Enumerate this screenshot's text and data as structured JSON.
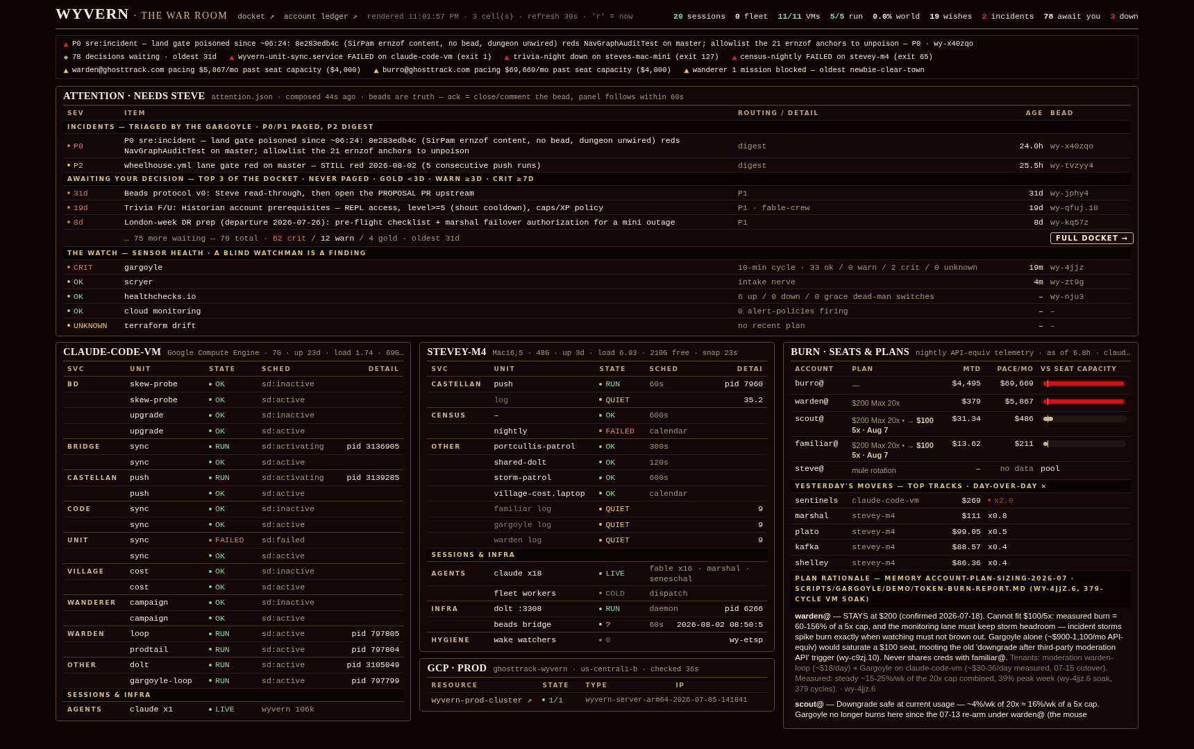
{
  "header": {
    "logo": "WYVERN",
    "subtitle": "· THE WAR ROOM",
    "links": [
      {
        "label": "docket ↗"
      },
      {
        "label": "account ledger ↗"
      }
    ],
    "meta": "rendered 11:01:57 PM · 3 cell(s) · refresh 30s · 'r' = now",
    "stats": [
      {
        "count": "20",
        "text": "sessions",
        "color": "#8fd49a"
      },
      {
        "count": "0",
        "text": "fleet",
        "color": "#f2e8d4"
      },
      {
        "count": "11/11",
        "text": "VMs",
        "color": "#8fd49a"
      },
      {
        "count": "5/5",
        "text": "run",
        "color": "#8fd49a"
      },
      {
        "count": "0.0%",
        "text": "world",
        "color": "#f2e8d4"
      },
      {
        "count": "19",
        "text": "wishes",
        "color": "#f2e8d4"
      },
      {
        "count": "2",
        "text": "incidents",
        "color": "#e03030"
      },
      {
        "count": "78",
        "text": "await you",
        "color": "#f2e8d4"
      },
      {
        "count": "3",
        "text": "down",
        "color": "#e03030"
      }
    ]
  },
  "alerts": [
    {
      "items": [
        {
          "kind": "crit",
          "text": "P0 sre:incident — land gate poisoned since ~06:24: 8e283edb4c (SirPam ernzof content, no bead, dungeon unwired) reds NavGraphAuditTest on master; allowlist the 21 ernzof anchors to unpoison — P0 · wy-x40zqo"
        }
      ]
    },
    {
      "items": [
        {
          "kind": "decision",
          "text": "78 decisions waiting · oldest 31d"
        },
        {
          "kind": "crit",
          "text": "wyvern-unit-sync.service FAILED on claude-code-vm (exit 1)"
        },
        {
          "kind": "crit",
          "text": "trivia-night down on steves-mac-mini (exit 127)"
        },
        {
          "kind": "crit",
          "text": "census-nightly FAILED on stevey-m4 (exit 65)"
        }
      ]
    },
    {
      "items": [
        {
          "kind": "warn",
          "text": "warden@ghosttrack.com pacing $5,867/mo past seat capacity ($4,000)"
        },
        {
          "kind": "warn",
          "text": "burro@ghosttrack.com pacing $69,669/mo past seat capacity ($4,000)"
        },
        {
          "kind": "warn",
          "text": "wanderer 1 mission blocked — oldest newbie-clear-town"
        }
      ]
    }
  ],
  "attention": {
    "title": "ATTENTION · NEEDS STEVE",
    "meta": "attention.json · composed 44s ago · beads are truth — ack = close/comment the bead, panel follows within 60s",
    "columns": [
      "SEV",
      "ITEM",
      "ROUTING / DETAIL",
      "AGE",
      "BEAD"
    ],
    "rows": [
      {
        "kind": "section",
        "text": "INCIDENTS — TRIAGED BY THE GARGOYLE · P0/P1 PAGED, P2 DIGEST"
      },
      {
        "kind": "item",
        "sev": "P0",
        "color": "#d0805e",
        "item": "P0 sre:incident — land gate poisoned since ~06:24: 8e283edb4c (SirPam ernzof content, no bead, dungeon unwired) reds NavGraphAuditTest on master; allowlist the 21 ernzof anchors to unpoison",
        "detail": "digest",
        "age": "24.0h",
        "bead": "wy-x40zqo"
      },
      {
        "kind": "item",
        "sev": "P2",
        "color": "#e2c46e",
        "item": "wheelhouse.yml lane gate red on master — STILL red 2026-08-02 (5 consecutive push runs)",
        "detail": "digest",
        "age": "25.5h",
        "bead": "wy-tvzyy4"
      },
      {
        "kind": "section",
        "text": "AWAITING YOUR DECISION — TOP 3 OF THE DOCKET · NEVER PAGED · GOLD <3D · WARN ≥3D · CRIT ≥7D"
      },
      {
        "kind": "item",
        "sev": "31d",
        "color": "#d0805e",
        "item": "Beads protocol v0: Steve read-through, then open the PROPOSAL PR upstream",
        "detail": "P1",
        "age": "31d",
        "bead": "wy-jphy4"
      },
      {
        "kind": "item",
        "sev": "19d",
        "color": "#d0805e",
        "item": "Trivia F/U: Historian account prerequisites — REPL access, level>=5 (shout cooldown), caps/XP policy",
        "detail": "P1 · fable-crew",
        "age": "19d",
        "bead": "wy-qfuj.10"
      },
      {
        "kind": "item",
        "sev": "8d",
        "color": "#d0805e",
        "item": "London-week DR prep (departure 2026-07-26): pre-flight checklist + marshal failover authorization for a mini outage",
        "detail": "P1",
        "age": "8d",
        "bead": "wy-kq57z"
      },
      {
        "kind": "more",
        "parts": [
          {
            "text": "… 75 more waiting — 78 total · "
          },
          {
            "text": "62 crit",
            "color": "#d0805e"
          },
          {
            "text": " / "
          },
          {
            "text": "12 warn",
            "color": "#f2e8d4"
          },
          {
            "text": " / 4 gold · oldest 31d"
          }
        ],
        "button": "FULL DOCKET →"
      },
      {
        "kind": "section",
        "text": "THE WATCH — SENSOR HEALTH · A BLIND WATCHMAN IS A FINDING"
      },
      {
        "kind": "item",
        "sev": "CRIT",
        "color": "#d0805e",
        "item": "gargoyle",
        "detail": "10-min cycle · 33 ok / 0 warn / 2 crit / 0 unknown",
        "age": "19m",
        "bead": "wy-4jjz"
      },
      {
        "kind": "item",
        "sev": "OK",
        "color": "#8fd49a",
        "item": "scryer",
        "detail": "intake nerve",
        "age": "4m",
        "bead": "wy-zt9g"
      },
      {
        "kind": "item",
        "sev": "OK",
        "color": "#8fd49a",
        "item": "healthchecks.io",
        "detail": "6 up / 0 down / 0 grace dead-man switches",
        "age": "–",
        "bead": "wy-nju3"
      },
      {
        "kind": "item",
        "sev": "OK",
        "color": "#8fd49a",
        "item": "cloud monitoring",
        "detail": "0 alert-policies firing",
        "age": "–",
        "bead": "–"
      },
      {
        "kind": "item",
        "sev": "UNKNOWN",
        "color": "#e2c46e",
        "item": "terraform drift",
        "detail": "no recent plan",
        "age": "–",
        "bead": "–"
      }
    ]
  },
  "claude_vm": {
    "title": "CLAUDE-CODE-VM",
    "meta": "Google Compute Engine · 7G · up 23d · load 1.74 · 69G…",
    "columns": [
      "SVC",
      "UNIT",
      "STATE",
      "SCHED",
      "DETAIL"
    ],
    "groups": [
      {
        "svc": "BD",
        "rows": [
          {
            "unit": "skew-probe",
            "state": "OK",
            "color": "#8fd49a",
            "sched": "sd:inactive"
          },
          {
            "unit": "skew-probe",
            "state": "OK",
            "color": "#8fd49a",
            "sched": "sd:active"
          },
          {
            "unit": "upgrade",
            "state": "OK",
            "color": "#8fd49a",
            "sched": "sd:inactive"
          },
          {
            "unit": "upgrade",
            "state": "OK",
            "color": "#8fd49a",
            "sched": "sd:active"
          }
        ]
      },
      {
        "svc": "BRIDGE",
        "rows": [
          {
            "unit": "sync",
            "state": "RUN",
            "color": "#8fd49a",
            "sched": "sd:activating",
            "detail": "pid 3136905"
          },
          {
            "unit": "sync",
            "state": "OK",
            "color": "#8fd49a",
            "sched": "sd:active"
          }
        ]
      },
      {
        "svc": "CASTELLAN",
        "rows": [
          {
            "unit": "push",
            "state": "RUN",
            "color": "#8fd49a",
            "sched": "sd:activating",
            "detail": "pid 3139285"
          },
          {
            "unit": "push",
            "state": "OK",
            "color": "#8fd49a",
            "sched": "sd:active"
          }
        ]
      },
      {
        "svc": "CODE",
        "rows": [
          {
            "unit": "sync",
            "state": "OK",
            "color": "#8fd49a",
            "sched": "sd:inactive"
          },
          {
            "unit": "sync",
            "state": "OK",
            "color": "#8fd49a",
            "sched": "sd:active"
          }
        ]
      },
      {
        "svc": "UNIT",
        "rows": [
          {
            "unit": "sync",
            "state": "FAILED",
            "color": "#c98a6e",
            "sched": "sd:failed"
          },
          {
            "unit": "sync",
            "state": "OK",
            "color": "#8fd49a",
            "sched": "sd:active"
          }
        ]
      },
      {
        "svc": "VILLAGE",
        "rows": [
          {
            "unit": "cost",
            "state": "OK",
            "color": "#8fd49a",
            "sched": "sd:inactive"
          },
          {
            "unit": "cost",
            "state": "OK",
            "color": "#8fd49a",
            "sched": "sd:active"
          }
        ]
      },
      {
        "svc": "WANDERER",
        "rows": [
          {
            "unit": "campaign",
            "state": "OK",
            "color": "#8fd49a",
            "sched": "sd:inactive"
          },
          {
            "unit": "campaign",
            "state": "OK",
            "color": "#8fd49a",
            "sched": "sd:active"
          }
        ]
      },
      {
        "svc": "WARDEN",
        "rows": [
          {
            "unit": "loop",
            "state": "RUN",
            "color": "#8fd49a",
            "sched": "sd:active",
            "detail": "pid 797805"
          },
          {
            "unit": "prodtail",
            "state": "RUN",
            "color": "#8fd49a",
            "sched": "sd:active",
            "detail": "pid 797804"
          }
        ]
      },
      {
        "svc": "OTHER",
        "rows": [
          {
            "unit": "dolt",
            "state": "RUN",
            "color": "#8fd49a",
            "sched": "sd:active",
            "detail": "pid 3105049"
          },
          {
            "unit": "gargoyle-loop",
            "state": "RUN",
            "color": "#8fd49a",
            "sched": "sd:active",
            "detail": "pid 797799"
          }
        ]
      }
    ],
    "infra": {
      "title": "SESSIONS & INFRA",
      "groups": [
        {
          "svc": "AGENTS",
          "rows": [
            {
              "unit": "claude x1",
              "state": "LIVE",
              "color": "#8fd49a",
              "sched": "wyvern 106k"
            }
          ]
        }
      ]
    }
  },
  "stevey_m4": {
    "title": "STEVEY-M4",
    "meta": "Mac16,5 · 48G · up 3d · load 6.93 · 210G free · snap 23s",
    "columns": [
      "SVC",
      "UNIT",
      "STATE",
      "SCHED",
      "DETAI"
    ],
    "groups": [
      {
        "svc": "CASTELLAN",
        "rows": [
          {
            "unit": "push",
            "dim": false,
            "state": "RUN",
            "color": "#8fd49a",
            "sched": "60s",
            "detail": "pid 7960"
          },
          {
            "unit": "log",
            "dim": true,
            "state": "QUIET",
            "color": "#e2c46e",
            "detail": "35.2"
          }
        ]
      },
      {
        "svc": "CENSUS",
        "rows": [
          {
            "unit": "–",
            "dim": false,
            "state": "OK",
            "color": "#8fd49a",
            "sched": "600s"
          },
          {
            "unit": "nightly",
            "dim": false,
            "state": "FAILED",
            "color": "#d39070",
            "sched": "calendar"
          }
        ]
      },
      {
        "svc": "OTHER",
        "rows": [
          {
            "unit": "portcullis-patrol",
            "dim": false,
            "state": "OK",
            "color": "#8fd49a",
            "sched": "300s"
          },
          {
            "unit": "shared-dolt",
            "dim": false,
            "state": "OK",
            "color": "#8fd49a",
            "sched": "120s"
          },
          {
            "unit": "storm-patrol",
            "dim": false,
            "state": "OK",
            "color": "#8fd49a",
            "sched": "600s"
          },
          {
            "unit": "village-cost.laptop",
            "dim": false,
            "state": "OK",
            "color": "#8fd49a",
            "sched": "calendar"
          },
          {
            "unit": "familiar log",
            "dim": true,
            "state": "QUIET",
            "color": "#e2c46e",
            "detail": "9"
          },
          {
            "unit": "gargoyle log",
            "dim": true,
            "state": "QUIET",
            "color": "#e2c46e",
            "detail": "9"
          },
          {
            "unit": "warden log",
            "dim": true,
            "state": "QUIET",
            "color": "#e2c46e",
            "detail": "9"
          }
        ]
      }
    ],
    "infra": {
      "title": "SESSIONS & INFRA",
      "groups": [
        {
          "svc": "AGENTS",
          "rows": [
            {
              "unit": "claude x18",
              "dim": false,
              "state": "LIVE",
              "color": "#8fd49a",
              "sched": "fable x16 · marshal · seneschal"
            },
            {
              "unit": "fleet workers",
              "dim": false,
              "state": "COLD",
              "color": "#8a7a68",
              "sched": "dispatch"
            }
          ]
        },
        {
          "svc": "INFRA",
          "rows": [
            {
              "unit": "dolt :3308",
              "dim": false,
              "state": "RUN",
              "color": "#8fd49a",
              "sched": "daemon",
              "detail": "pid 6266"
            },
            {
              "unit": "beads bridge",
              "dim": false,
              "state": "?",
              "color": "#e2c46e",
              "sched": "60s",
              "detail": "2026-08-02 08:50:5"
            }
          ]
        },
        {
          "svc": "HYGIENE",
          "rows": [
            {
              "unit": "wake watchers",
              "dim": false,
              "state": "0",
              "color": "#8a7a68",
              "detail": "wy-etsp"
            }
          ]
        }
      ]
    }
  },
  "gcp": {
    "title": "GCP · PROD",
    "meta": "ghosttrack-wyvern · us-central1-b · checked 36s",
    "columns": [
      "RESOURCE",
      "STATE",
      "TYPE",
      "IP"
    ],
    "rows": [
      {
        "resource": "wyvern-prod-cluster ↗",
        "state": "1/1",
        "color": "#8fd49a",
        "type": "wyvern-server-arm64-2026-07-05-141841"
      }
    ]
  },
  "burn": {
    "title": "BURN · SEATS & PLANS",
    "meta": "nightly API-equiv telemetry · as of 6.8h · claud…",
    "columns": [
      "ACCOUNT",
      "PLAN",
      "MTD",
      "PACE/MO",
      "VS SEAT CAPACITY"
    ],
    "accounts": [
      {
        "kind": "bar",
        "account": "burro@",
        "plan": "—",
        "mtd": "$4,495",
        "pace": "$69,669",
        "level": 1,
        "over": true
      },
      {
        "kind": "bar",
        "account": "warden@",
        "plan": "$200 Max 20x",
        "mtd": "$379",
        "pace": "$5,867",
        "level": 1,
        "over": true
      },
      {
        "kind": "bar",
        "account": "scout@",
        "plan": "$200 Max 20x • → **$100 5x · Aug 7**",
        "mtd": "$31.34",
        "pace": "$486",
        "level": 0.12,
        "over": false
      },
      {
        "kind": "bar",
        "account": "familiar@",
        "plan": "$200 Max 20x • → **$100 5x · Aug 7**",
        "mtd": "$13.62",
        "pace": "$211",
        "level": 0.05,
        "over": false
      },
      {
        "kind": "text",
        "account": "steve@",
        "plan": "mule rotation",
        "mtd": "–",
        "pace": "no data",
        "capacity": "pool"
      }
    ],
    "movers_title": "YESTERDAY'S MOVERS — TOP TRACKS · DAY-OVER-DAY ×",
    "movers": [
      {
        "name": "sentinels",
        "host": "claude-code-vm",
        "mtd": "$269",
        "ratio": "x2.0",
        "hot": true
      },
      {
        "name": "marshal",
        "host": "stevey-m4",
        "mtd": "$111",
        "ratio": "x0.8",
        "hot": false
      },
      {
        "name": "plato",
        "host": "stevey-m4",
        "mtd": "$99.05",
        "ratio": "x0.5",
        "hot": false
      },
      {
        "name": "kafka",
        "host": "stevey-m4",
        "mtd": "$88.57",
        "ratio": "x0.4",
        "hot": false
      },
      {
        "name": "shelley",
        "host": "stevey-m4",
        "mtd": "$86.36",
        "ratio": "x0.4",
        "hot": false
      }
    ],
    "rationale_title": "PLAN RATIONALE — MEMORY ACCOUNT-PLAN-SIZING-2026-07 · SCRIPTS/GARGOYLE/DEMO/TOKEN-BURN-REPORT.MD (WY-4JJZ.6, 379-CYCLE VM SOAK)",
    "notes": [
      {
        "text": "**warden@** — STAYS at $200 (confirmed 2026-07-18). Cannot fit $100/5x: measured burn = 60-156% of a 5x cap, and the monitoring lane must keep storm headroom — incident storms spike burn exactly when watching must not brown out. Gargoyle alone (~$900-1,100/mo API-equiv) would saturate a $100 seat, mooting the old 'downgrade after third-party moderation API' trigger (wy-c9zj.10). Never shares creds with familiar@.",
        "tenants": "Tenants: moderation warden-loop (~$18/day) + Gargoyle on claude-code-vm (~$30-36/day measured, 07-15 cutover). Measured: steady ~15-25%/wk of the 20x cap combined, 39% peak week (wy-4jjz.6 soak, 379 cycles). · wy-4jjz.6"
      },
      {
        "text": "**scout@** — Downgrade safe at current usage — ~4%/wk of 20x ≈ 16%/wk of a 5x cap. Gargoyle no longer burns here since the 07-13 re-arm under warden@ (the mouse"
      }
    ]
  }
}
